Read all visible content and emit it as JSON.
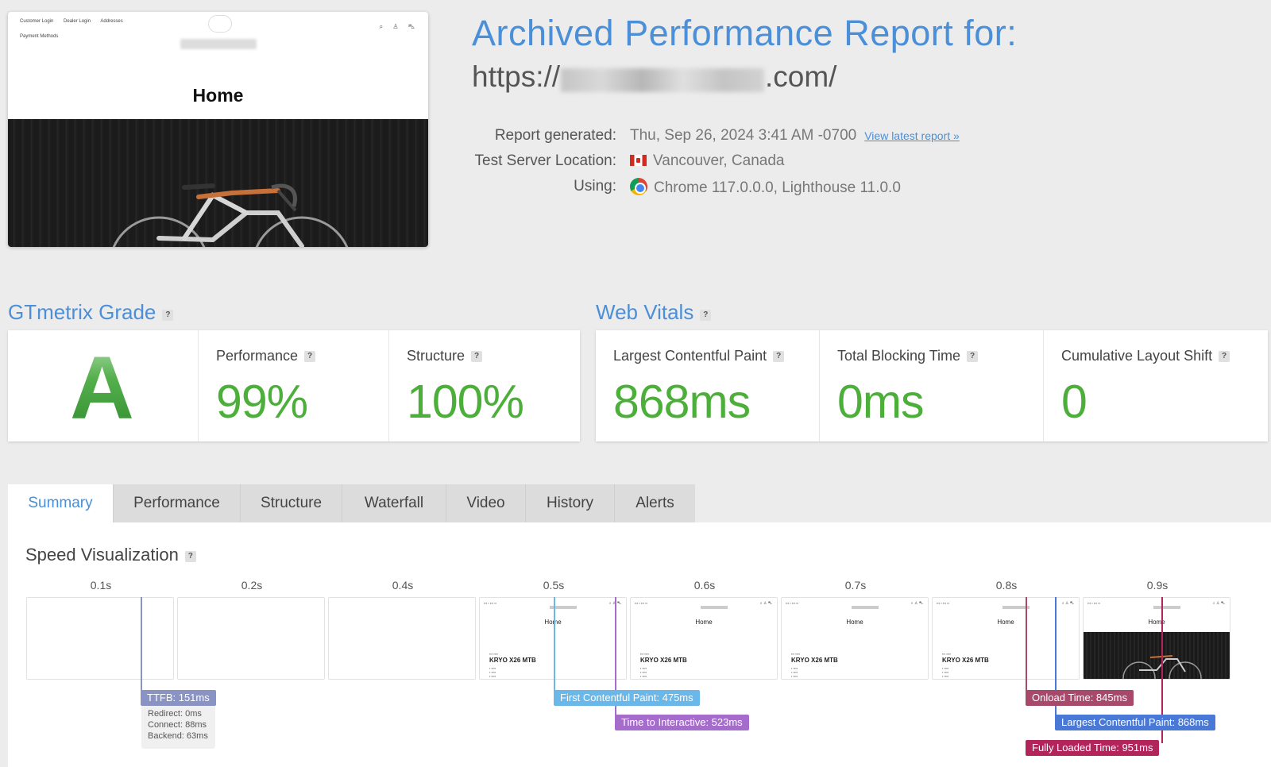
{
  "thumbnail": {
    "nav": [
      "Customer Login",
      "Dealer Login",
      "Addresses"
    ],
    "nav2": "Payment Methods",
    "page_title": "Home"
  },
  "report": {
    "title": "Archived Performance Report for:",
    "url_prefix": "https://",
    "url_suffix": ".com/",
    "generated_label": "Report generated:",
    "generated_value": "Thu, Sep 26, 2024 3:41 AM -0700",
    "view_latest": "View latest report »",
    "location_label": "Test Server Location:",
    "location_value": "Vancouver, Canada",
    "using_label": "Using:",
    "using_value": "Chrome 117.0.0.0, Lighthouse 11.0.0",
    "icons": {
      "flag": "canada-flag-icon",
      "browser": "chrome-icon"
    }
  },
  "grade": {
    "section_title": "GTmetrix Grade",
    "help": "?",
    "letter": "A",
    "performance_label": "Performance",
    "performance_value": "99%",
    "structure_label": "Structure",
    "structure_value": "100%"
  },
  "vitals": {
    "section_title": "Web Vitals",
    "help": "?",
    "lcp_label": "Largest Contentful Paint",
    "lcp_value": "868ms",
    "tbt_label": "Total Blocking Time",
    "tbt_value": "0ms",
    "cls_label": "Cumulative Layout Shift",
    "cls_value": "0"
  },
  "tabs": [
    "Summary",
    "Performance",
    "Structure",
    "Waterfall",
    "Video",
    "History",
    "Alerts"
  ],
  "active_tab": "Summary",
  "speed": {
    "title": "Speed Visualization",
    "help": "?",
    "ticks": [
      "0.1s",
      "0.2s",
      "0.4s",
      "0.5s",
      "0.6s",
      "0.7s",
      "0.8s",
      "0.9s"
    ],
    "frame_home": "Home",
    "frame_product": "KRYO X26 MTB",
    "ttfb": "TTFB: 151ms",
    "ttfb_details": [
      "Redirect: 0ms",
      "Connect: 88ms",
      "Backend: 63ms"
    ],
    "fcp": "First Contentful Paint: 475ms",
    "tti": "Time to Interactive: 523ms",
    "onload": "Onload Time: 845ms",
    "lcp": "Largest Contentful Paint: 868ms",
    "fully_loaded": "Fully Loaded Time: 951ms",
    "colors": {
      "ttfb": "#8a94c4",
      "fcp": "#6ab7ea",
      "tti": "#a56ccc",
      "onload": "#a8496b",
      "lcp": "#4a78d6",
      "fully_loaded": "#b2245a"
    }
  }
}
